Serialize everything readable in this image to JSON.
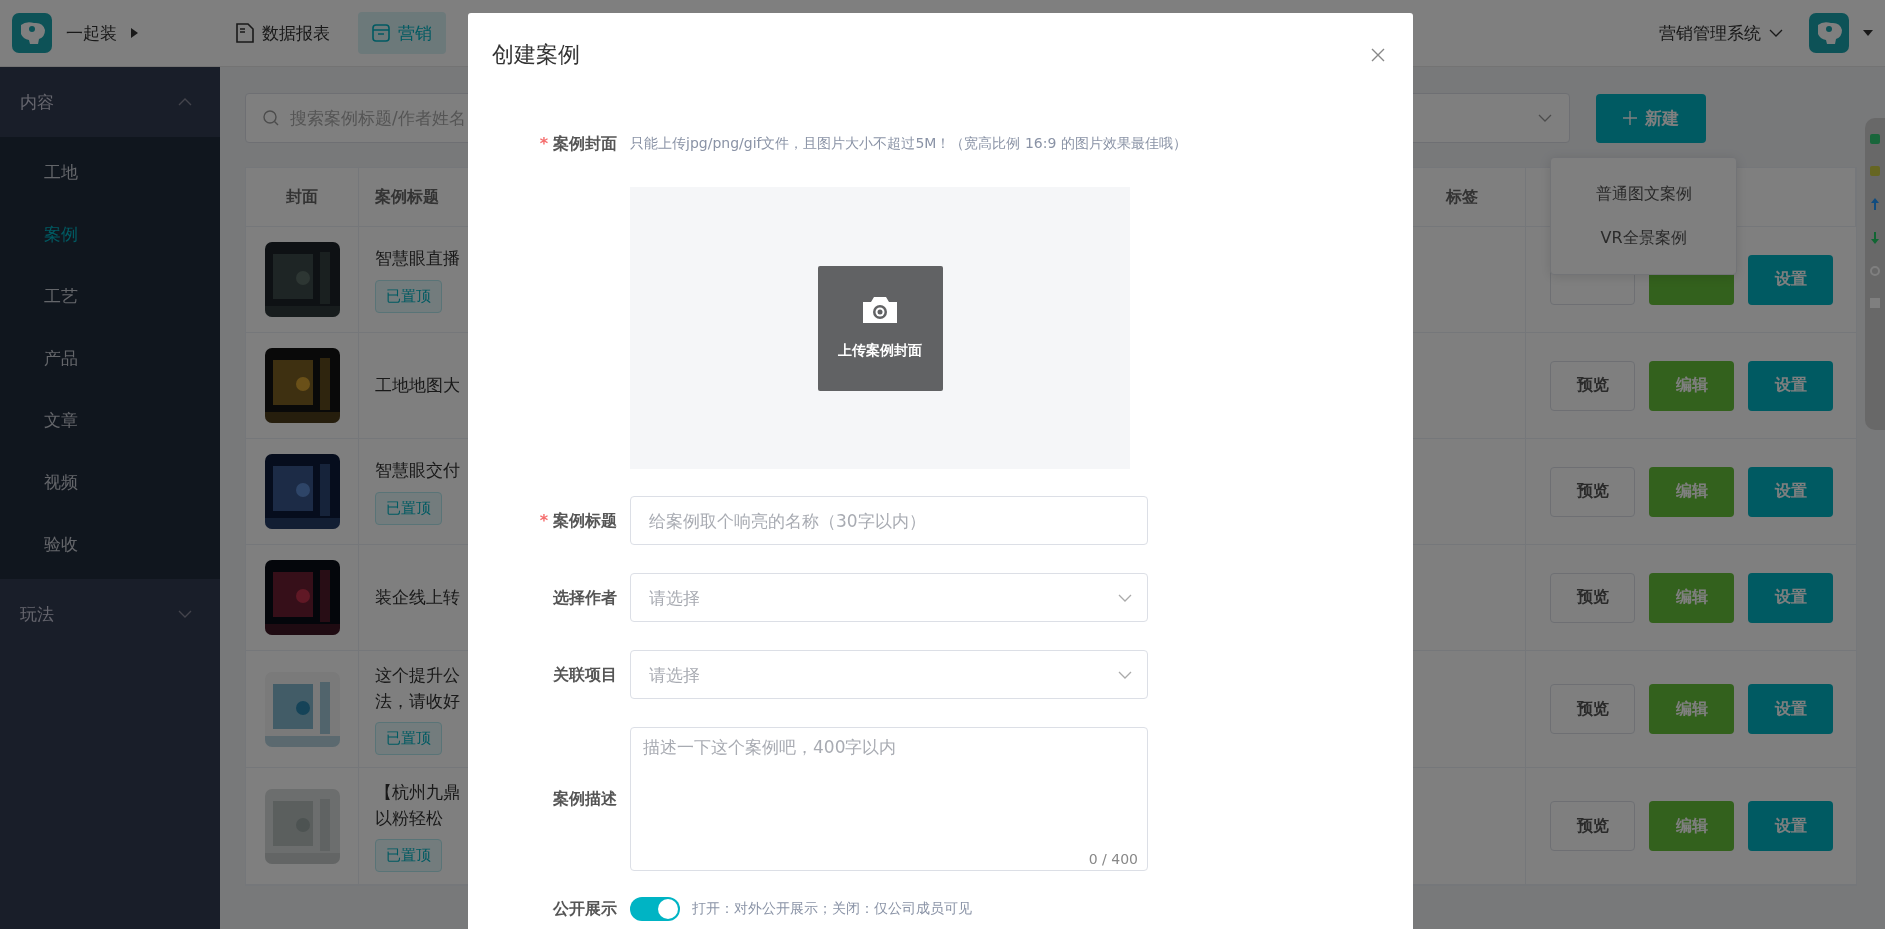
{
  "header": {
    "brand": "一起装",
    "nav": [
      {
        "label": "数据报表",
        "kind": "report",
        "selected": false
      },
      {
        "label": "营销",
        "kind": "box",
        "selected": true
      }
    ],
    "system": "营销管理系统"
  },
  "sidebar": {
    "groups": [
      {
        "label": "内容",
        "expanded": true,
        "items": [
          {
            "label": "工地",
            "selected": false
          },
          {
            "label": "案例",
            "selected": true
          },
          {
            "label": "工艺",
            "selected": false
          },
          {
            "label": "产品",
            "selected": false
          },
          {
            "label": "文章",
            "selected": false
          },
          {
            "label": "视频",
            "selected": false
          },
          {
            "label": "验收",
            "selected": false
          }
        ]
      },
      {
        "label": "玩法",
        "expanded": false
      }
    ]
  },
  "toolbar": {
    "search_placeholder": "搜索案例标题/作者姓名",
    "new_button": "新建",
    "new_menu": [
      "普通图文案例",
      "VR全景案例"
    ]
  },
  "table": {
    "columns": [
      {
        "label": "封面",
        "kind": "cover"
      },
      {
        "label": "案例标题",
        "kind": "title"
      },
      {
        "label": "标签",
        "kind": "tag"
      },
      {
        "kind": "actions"
      }
    ],
    "rows": [
      {
        "title": [
          "智慧眼直播"
        ],
        "pinned": true,
        "tag": "已置顶",
        "actions": [
          {
            "kind": "preview"
          },
          {
            "kind": "edit"
          },
          {
            "kind": "settings",
            "label": "设置"
          }
        ]
      },
      {
        "title": [
          "工地地图大"
        ],
        "pinned": false,
        "actions": [
          {
            "kind": "preview",
            "label": "预览"
          },
          {
            "kind": "edit",
            "label": "编辑"
          },
          {
            "kind": "settings",
            "label": "设置"
          }
        ]
      },
      {
        "title": [
          "智慧眼交付"
        ],
        "pinned": true,
        "tag": "已置顶",
        "actions": [
          {
            "kind": "preview",
            "label": "预览"
          },
          {
            "kind": "edit",
            "label": "编辑"
          },
          {
            "kind": "settings",
            "label": "设置"
          }
        ]
      },
      {
        "title": [
          "装企线上转"
        ],
        "pinned": false,
        "actions": [
          {
            "kind": "preview",
            "label": "预览"
          },
          {
            "kind": "edit",
            "label": "编辑"
          },
          {
            "kind": "settings",
            "label": "设置"
          }
        ]
      },
      {
        "title": [
          "这个提升公",
          "法，请收好"
        ],
        "pinned": true,
        "tag": "已置顶",
        "actions": [
          {
            "kind": "preview",
            "label": "预览"
          },
          {
            "kind": "edit",
            "label": "编辑"
          },
          {
            "kind": "settings",
            "label": "设置"
          }
        ]
      },
      {
        "title": [
          "【杭州九鼎",
          "以粉轻松"
        ],
        "pinned": true,
        "tag": "已置顶",
        "actions": [
          {
            "kind": "preview",
            "label": "预览"
          },
          {
            "kind": "edit",
            "label": "编辑"
          },
          {
            "kind": "settings",
            "label": "设置"
          }
        ]
      }
    ]
  },
  "modal": {
    "title": "创建案例",
    "required_mark": "*",
    "cover": {
      "label": "案例封面",
      "required": true,
      "hint": "只能上传jpg/png/gif文件，且图片大小不超过5M！（宽高比例 16:9 的图片效果最佳哦）",
      "upload_label": "上传案例封面"
    },
    "fields": [
      {
        "label": "案例标题",
        "required": true,
        "kind": "input",
        "placeholder": "给案例取个响亮的名称（30字以内）"
      },
      {
        "label": "选择作者",
        "required": false,
        "kind": "select",
        "placeholder": "请选择"
      },
      {
        "label": "关联项目",
        "required": false,
        "kind": "select",
        "placeholder": "请选择"
      },
      {
        "label": "案例描述",
        "required": false,
        "kind": "textarea",
        "placeholder": "描述一下这个案例吧，400字以内",
        "counter": "0 / 400"
      }
    ],
    "public_display": {
      "label": "公开展示",
      "on": true,
      "hint": "打开：对外公开展示；关闭：仅公司成员可见"
    }
  }
}
